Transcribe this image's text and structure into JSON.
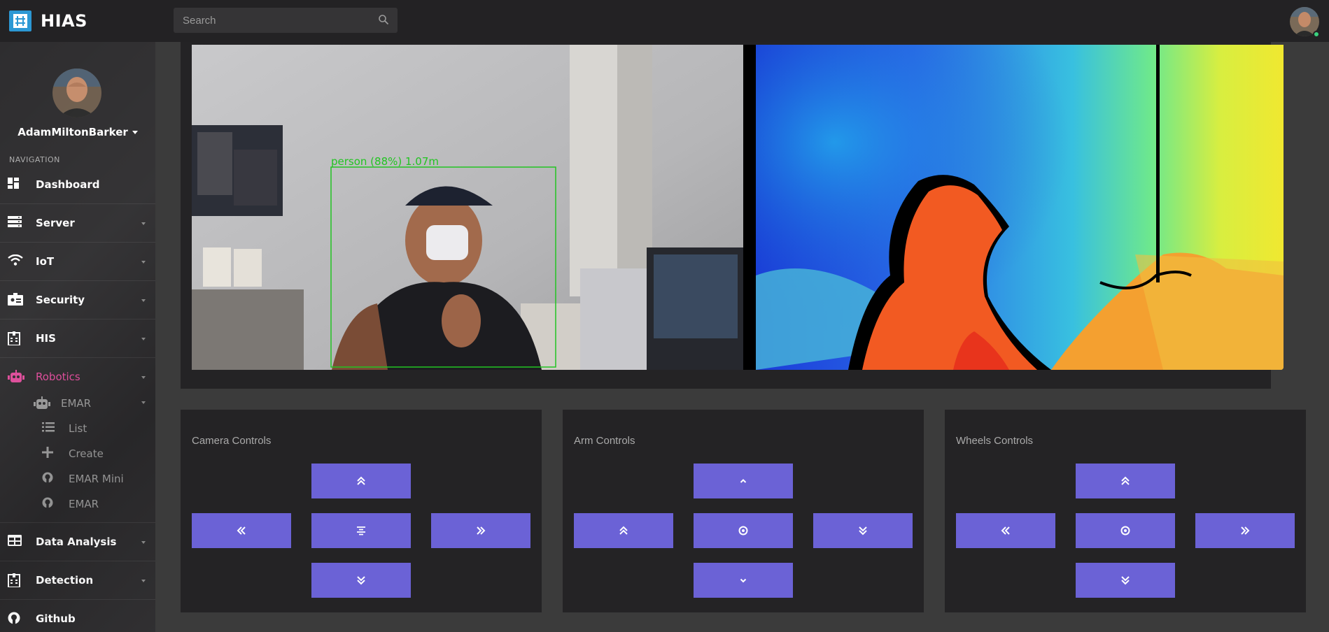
{
  "app": {
    "brand": "HIAS"
  },
  "search": {
    "placeholder": "Search"
  },
  "user": {
    "name": "AdamMiltonBarker"
  },
  "sidebar": {
    "header": "NAVIGATION",
    "items": [
      {
        "label": "Dashboard",
        "icon": "dashboard-icon"
      },
      {
        "label": "Server",
        "icon": "server-icon"
      },
      {
        "label": "IoT",
        "icon": "wifi-icon"
      },
      {
        "label": "Security",
        "icon": "id-badge-icon"
      },
      {
        "label": "HIS",
        "icon": "hospital-icon"
      },
      {
        "label": "Robotics",
        "icon": "robot-icon",
        "active": true
      },
      {
        "label": "Data Analysis",
        "icon": "table-icon"
      },
      {
        "label": "Detection",
        "icon": "building-icon"
      },
      {
        "label": "Github",
        "icon": "github-icon"
      }
    ],
    "robotics_sub": {
      "group": "EMAR",
      "items": [
        {
          "label": "List",
          "icon": "list-icon"
        },
        {
          "label": "Create",
          "icon": "plus-icon"
        },
        {
          "label": "EMAR Mini",
          "icon": "github-icon"
        },
        {
          "label": "EMAR",
          "icon": "github-icon"
        }
      ]
    }
  },
  "camera_feed": {
    "detection_label": "person (88%) 1.07m"
  },
  "controls": {
    "camera": {
      "title": "Camera Controls"
    },
    "arm": {
      "title": "Arm Controls"
    },
    "wheels": {
      "title": "Wheels Controls"
    }
  },
  "colors": {
    "accent": "#6b62d6",
    "active_nav": "#e04a9a",
    "topbar": "#232224",
    "sidebar": "#2a292b",
    "panel": "#242325"
  }
}
